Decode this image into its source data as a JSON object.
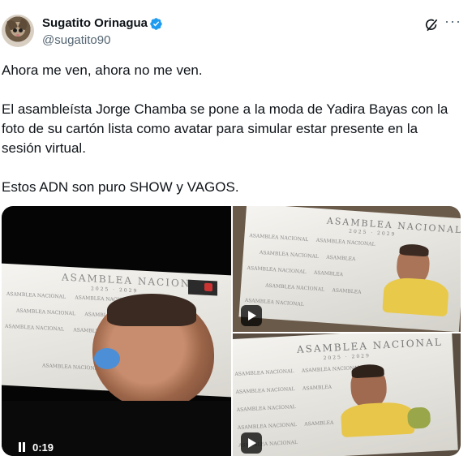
{
  "author": {
    "display_name": "Sugatito Orinagua",
    "handle": "@sugatito90",
    "verified": true
  },
  "icons": {
    "verified": "verified-badge-icon",
    "grok": "grok-icon",
    "more": "more-options-icon",
    "play": "play-icon",
    "pause": "pause-icon"
  },
  "colors": {
    "verified_blue": "#1d9bf0",
    "text_primary": "#0f1419",
    "text_secondary": "#536471"
  },
  "tweet": {
    "paragraph_1": "Ahora me ven, ahora no me ven.",
    "paragraph_2": "El asambleísta Jorge Chamba se pone a la moda de Yadira Bayas con la foto de su cartón lista como avatar para simular estar presente en la sesión virtual.",
    "paragraph_3": "Estos ADN son puro SHOW y VAGOS."
  },
  "media": {
    "video_time": "0:19",
    "screen_title": "ASAMBLEA NACIONAL",
    "screen_years": "2025 · 2029"
  }
}
